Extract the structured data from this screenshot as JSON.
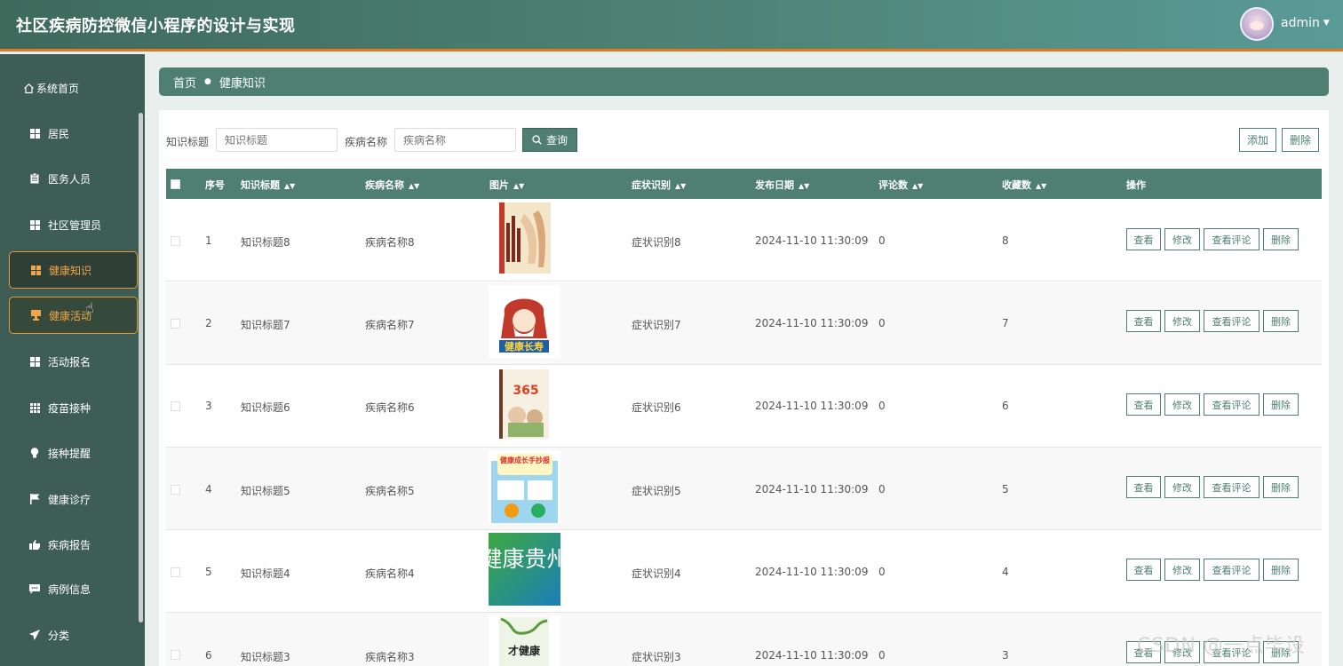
{
  "header": {
    "title": "社区疾病防控微信小程序的设计与实现",
    "user": "admin"
  },
  "sidebar": {
    "items": [
      {
        "label": "系统首页",
        "icon": "home-icon"
      },
      {
        "label": "居民",
        "icon": "grid-icon"
      },
      {
        "label": "医务人员",
        "icon": "clipboard-icon"
      },
      {
        "label": "社区管理员",
        "icon": "grid-icon"
      },
      {
        "label": "健康知识",
        "icon": "grid-icon"
      },
      {
        "label": "健康活动",
        "icon": "trophy-icon"
      },
      {
        "label": "活动报名",
        "icon": "grid-icon"
      },
      {
        "label": "疫苗接种",
        "icon": "apps-icon"
      },
      {
        "label": "接种提醒",
        "icon": "bulb-icon"
      },
      {
        "label": "健康诊疗",
        "icon": "flag-icon"
      },
      {
        "label": "疾病报告",
        "icon": "thumb-icon"
      },
      {
        "label": "病例信息",
        "icon": "message-icon"
      },
      {
        "label": "分类",
        "icon": "send-icon"
      }
    ]
  },
  "breadcrumb": {
    "home": "首页",
    "current": "健康知识"
  },
  "filters": {
    "title_label": "知识标题",
    "title_placeholder": "知识标题",
    "disease_label": "疾病名称",
    "disease_placeholder": "疾病名称",
    "search_button": "查询"
  },
  "toolbar": {
    "add": "添加",
    "delete": "删除"
  },
  "table": {
    "columns": [
      "序号",
      "知识标题",
      "疾病名称",
      "图片",
      "症状识别",
      "发布日期",
      "评论数",
      "收藏数",
      "操作"
    ],
    "rows": [
      {
        "index": "1",
        "title": "知识标题8",
        "disease": "疾病名称8",
        "symptom": "症状识别8",
        "date": "2024-11-10 11:30:09",
        "comments": "0",
        "favorites": "8",
        "image": "book-cover-meridian"
      },
      {
        "index": "2",
        "title": "知识标题7",
        "disease": "疾病名称7",
        "symptom": "症状识别7",
        "date": "2024-11-10 11:30:09",
        "comments": "0",
        "favorites": "7",
        "image": "longevity-cartoon",
        "image_caption": "健康长寿"
      },
      {
        "index": "3",
        "title": "知识标题6",
        "disease": "疾病名称6",
        "symptom": "症状识别6",
        "date": "2024-11-10 11:30:09",
        "comments": "0",
        "favorites": "6",
        "image": "book-cover-365",
        "image_caption": "365"
      },
      {
        "index": "4",
        "title": "知识标题5",
        "disease": "疾病名称5",
        "symptom": "症状识别5",
        "date": "2024-11-10 11:30:09",
        "comments": "0",
        "favorites": "5",
        "image": "health-poster",
        "image_caption": "健康成长手抄报"
      },
      {
        "index": "5",
        "title": "知识标题4",
        "disease": "疾病名称4",
        "symptom": "症状识别4",
        "date": "2024-11-10 11:30:09",
        "comments": "0",
        "favorites": "4",
        "image": "guizhou-logo",
        "image_caption": "健康贵州"
      },
      {
        "index": "6",
        "title": "知识标题3",
        "disease": "疾病名称3",
        "symptom": "症状识别3",
        "date": "2024-11-10 11:30:09",
        "comments": "0",
        "favorites": "3",
        "image": "book-cover-health",
        "image_caption": "才健康"
      }
    ],
    "actions": {
      "view": "查看",
      "edit": "修改",
      "view_comments": "查看评论",
      "delete": "删除"
    }
  },
  "watermark": "CSDN @一点毕设",
  "colors": {
    "primary": "#4e7f71",
    "sidebar": "#3e5e55",
    "accent": "#e39b3a",
    "header_stripe": "#e07a1f"
  }
}
